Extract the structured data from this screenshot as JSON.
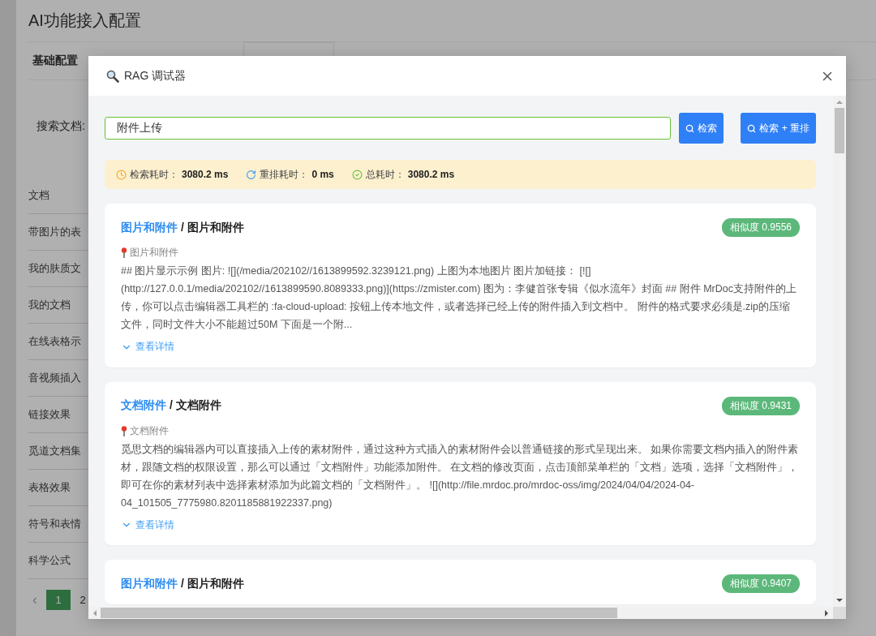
{
  "page": {
    "title": "AI功能接入配置",
    "tab": "基础配置",
    "search_label": "搜索文档:",
    "docs": [
      "文档",
      "带图片的表",
      "我的肤质文",
      "我的文档",
      "在线表格示",
      "音视频插入",
      "链接效果",
      "觅道文档集",
      "表格效果",
      "符号和表情",
      "科学公式"
    ],
    "pagination": {
      "prev": "‹",
      "pages": [
        {
          "label": "1",
          "selected": true
        },
        {
          "label": "2",
          "selected": false
        }
      ]
    }
  },
  "dialog": {
    "title": "RAG 调试器",
    "query": "附件上传",
    "buttons": [
      "检索",
      "检索 + 重排"
    ],
    "stats": [
      {
        "kind": "clock",
        "label": "检索耗时：",
        "value": "3080.2 ms"
      },
      {
        "kind": "refresh",
        "label": "重排耗时：",
        "value": "0 ms"
      },
      {
        "kind": "check",
        "label": "总耗时：",
        "value": "3080.2 ms"
      }
    ],
    "results": [
      {
        "link": "图片和附件",
        "rest": "/ 图片和附件",
        "score": "相似度 0.9556",
        "path": "图片和附件",
        "text": "## 图片显示示例 图片: ![](/media/202102//1613899592.3239121.png) 上图为本地图片 图片加链接： [![](http://127.0.0.1/media/202102//1613899590.8089333.png)](https://zmister.com) 图为：李健首张专辑《似水流年》封面 ## 附件 MrDoc支持附件的上传，你可以点击编辑器工具栏的 :fa-cloud-upload: 按钮上传本地文件，或者选择已经上传的附件插入到文档中。 附件的格式要求必须是.zip的压缩文件，同时文件大小不能超过50M 下面是一个附...",
        "more": "查看详情"
      },
      {
        "link": "文档附件",
        "rest": "/ 文档附件",
        "score": "相似度 0.9431",
        "path": "文档附件",
        "text": "觅思文档的编辑器内可以直接插入上传的素材附件，通过这种方式插入的素材附件会以普通链接的形式呈现出来。 如果你需要文档内插入的附件素材，跟随文档的权限设置，那么可以通过「文档附件」功能添加附件。 在文档的修改页面，点击顶部菜单栏的「文档」选项，选择「文档附件」，即可在你的素材列表中选择素材添加为此篇文档的「文档附件」。 ![](http://file.mrdoc.pro/mrdoc-oss/img/2024/04/04/2024-04-04_101505_7775980.8201185881922337.png)",
        "more": "查看详情"
      },
      {
        "link": "图片和附件",
        "rest": "/ 图片和附件",
        "score": "相似度 0.9407"
      }
    ]
  }
}
